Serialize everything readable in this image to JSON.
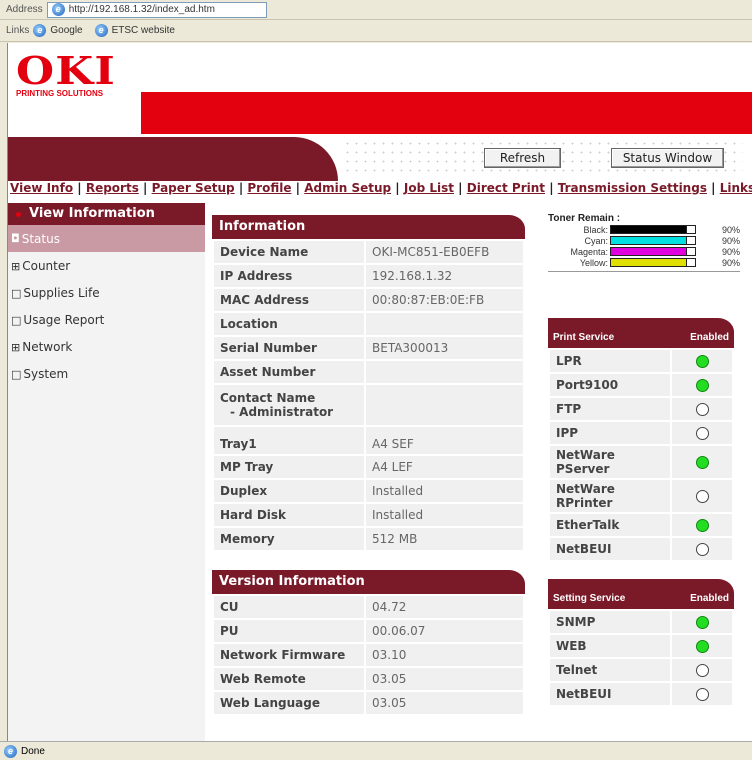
{
  "browser": {
    "address_label": "Address",
    "url": "http://192.168.1.32/index_ad.htm",
    "links_label": "Links",
    "links": [
      "Google",
      "ETSC website"
    ],
    "status": "Done"
  },
  "header": {
    "brand": "OKI",
    "brand_sub": "PRINTING SOLUTIONS",
    "refresh_label": "Refresh",
    "status_window_label": "Status Window"
  },
  "nav": {
    "items": [
      "View Info",
      "Reports",
      "Paper Setup",
      "Profile",
      "Admin Setup",
      "Job List",
      "Direct Print",
      "Transmission Settings",
      "Links"
    ],
    "separator": "|"
  },
  "sidebar": {
    "title": "View Information",
    "items": [
      {
        "glyph": "◘",
        "label": "Status"
      },
      {
        "glyph": "⊞",
        "label": "Counter"
      },
      {
        "glyph": "□",
        "label": "Supplies Life"
      },
      {
        "glyph": "□",
        "label": "Usage Report"
      },
      {
        "glyph": "⊞",
        "label": "Network"
      },
      {
        "glyph": "□",
        "label": "System"
      }
    ]
  },
  "information": {
    "title": "Information",
    "rows": [
      {
        "k": "Device Name",
        "v": "OKI-MC851-EB0EFB"
      },
      {
        "k": "IP Address",
        "v": "192.168.1.32"
      },
      {
        "k": "MAC Address",
        "v": "00:80:87:EB:0E:FB"
      },
      {
        "k": "Location",
        "v": ""
      },
      {
        "k": "Serial Number",
        "v": "BETA300013"
      },
      {
        "k": "Asset Number",
        "v": ""
      },
      {
        "k": "Contact Name",
        "k2": "- Administrator",
        "v": ""
      },
      {
        "k": "Tray1",
        "v": "A4 SEF"
      },
      {
        "k": "MP Tray",
        "v": "A4 LEF"
      },
      {
        "k": "Duplex",
        "v": "Installed"
      },
      {
        "k": "Hard Disk",
        "v": "Installed"
      },
      {
        "k": "Memory",
        "v": "512 MB"
      }
    ]
  },
  "version": {
    "title": "Version Information",
    "rows": [
      {
        "k": "CU",
        "v": "04.72"
      },
      {
        "k": "PU",
        "v": "00.06.07"
      },
      {
        "k": "Network Firmware",
        "v": "03.10"
      },
      {
        "k": "Web Remote",
        "v": "03.05"
      },
      {
        "k": "Web Language",
        "v": "03.05"
      }
    ]
  },
  "toner": {
    "title": "Toner Remain :",
    "items": [
      {
        "name": "Black:",
        "pct": "90%",
        "level": 0.9,
        "color": "#000000"
      },
      {
        "name": "Cyan:",
        "pct": "90%",
        "level": 0.9,
        "color": "#00e0e0"
      },
      {
        "name": "Magenta:",
        "pct": "90%",
        "level": 0.9,
        "color": "#e000e0"
      },
      {
        "name": "Yellow:",
        "pct": "90%",
        "level": 0.9,
        "color": "#e0e000"
      }
    ]
  },
  "print_service": {
    "title": "Print Service",
    "status_header": "Enabled",
    "rows": [
      {
        "name": "LPR",
        "enabled": true
      },
      {
        "name": "Port9100",
        "enabled": true
      },
      {
        "name": "FTP",
        "enabled": false
      },
      {
        "name": "IPP",
        "enabled": false
      },
      {
        "name": "NetWare",
        "name2": "PServer",
        "enabled": true
      },
      {
        "name": "NetWare",
        "name2": "RPrinter",
        "enabled": false
      },
      {
        "name": "EtherTalk",
        "enabled": true
      },
      {
        "name": "NetBEUI",
        "enabled": false
      }
    ]
  },
  "setting_service": {
    "title": "Setting Service",
    "status_header": "Enabled",
    "rows": [
      {
        "name": "SNMP",
        "enabled": true
      },
      {
        "name": "WEB",
        "enabled": true
      },
      {
        "name": "Telnet",
        "enabled": false
      },
      {
        "name": "NetBEUI",
        "enabled": false
      }
    ]
  },
  "colors": {
    "brand_red": "#e3000f",
    "maroon": "#7a1a29",
    "enabled_green": "#22dd22"
  }
}
